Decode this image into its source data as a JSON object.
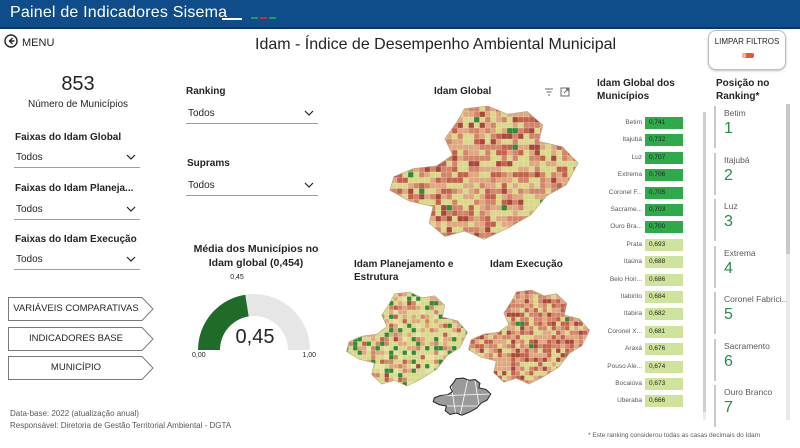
{
  "header": {
    "app_title": "Painel de Indicadores Sisema",
    "flag_colors": [
      "#1e9e4a",
      "#d62828",
      "#1e9e4a"
    ]
  },
  "nav": {
    "menu_label": "MENU",
    "back_icon": "circle-arrow-left-icon"
  },
  "page_title": "Idam - Índice de Desempenho Ambiental Municipal",
  "clear_filters": {
    "label": "LIMPAR FILTROS",
    "icon": "eraser-icon"
  },
  "kpi": {
    "value": "853",
    "label": "Número de Municípios"
  },
  "filters": {
    "global": {
      "label": "Faixas do Idam Global",
      "value": "Todos"
    },
    "planejamento": {
      "label": "Faixas do Idam Planeja...",
      "value": "Todos"
    },
    "execucao": {
      "label": "Faixas do Idam Execução",
      "value": "Todos"
    },
    "ranking": {
      "label": "Ranking",
      "value": "Todos"
    },
    "suprams": {
      "label": "Suprams",
      "value": "Todos"
    }
  },
  "buttons": {
    "variaveis": "VARIÁVEIS COMPARATIVAS",
    "indicadores": "INDICADORES BASE",
    "municipio": "MUNICÍPIO"
  },
  "footer": {
    "line1": "Data-base: 2022 (atualização anual)",
    "line2": "Responsável: Diretoria de Gestão Territorial Ambiental - DGTA"
  },
  "gauge": {
    "title": "Média dos Municípios no Idam global (0,454)",
    "value": 0.45,
    "value_label": "0,45",
    "min_label": "0,00",
    "max_label": "1,00",
    "target_label": "0,45",
    "fill_color": "#1f6b2a",
    "track_color": "#e6e6e6"
  },
  "maps": {
    "global_title": "Idam Global",
    "planejamento_title": "Idam Planejamento e Estrutura",
    "execucao_title": "Idam Execução",
    "filter_icon": "filter-icon",
    "focus_icon": "focus-mode-icon",
    "palette": [
      "#d9d98a",
      "#e0a882",
      "#d4846a",
      "#c4614e",
      "#a9473e",
      "#2e8b3a",
      "#e8e3a0"
    ]
  },
  "ranking_bars": {
    "title": "Idam Global dos Municípios",
    "rows": [
      {
        "name": "Betim",
        "value": "0,741",
        "color": "#2eaa4a"
      },
      {
        "name": "Itajubá",
        "value": "0,732",
        "color": "#2eaa4a"
      },
      {
        "name": "Luz",
        "value": "0,707",
        "color": "#2eaa4a"
      },
      {
        "name": "Extrema",
        "value": "0,706",
        "color": "#2eaa4a"
      },
      {
        "name": "Coronel F...",
        "value": "0,705",
        "color": "#2eaa4a"
      },
      {
        "name": "Sacrame...",
        "value": "0,703",
        "color": "#2eaa4a"
      },
      {
        "name": "Ouro Bra...",
        "value": "0,700",
        "color": "#2eaa4a"
      },
      {
        "name": "Prata",
        "value": "0,693",
        "color": "#cfe39a"
      },
      {
        "name": "Itaúna",
        "value": "0,688",
        "color": "#cfe39a"
      },
      {
        "name": "Belo Hori...",
        "value": "0,686",
        "color": "#cfe39a"
      },
      {
        "name": "Itabirito",
        "value": "0,684",
        "color": "#cfe39a"
      },
      {
        "name": "Itabira",
        "value": "0,682",
        "color": "#cfe39a"
      },
      {
        "name": "Coronel X...",
        "value": "0,681",
        "color": "#cfe39a"
      },
      {
        "name": "Araxá",
        "value": "0,676",
        "color": "#cfe39a"
      },
      {
        "name": "Pouso Ale...",
        "value": "0,674",
        "color": "#cfe39a"
      },
      {
        "name": "Bocaiúva",
        "value": "0,673",
        "color": "#cfe39a"
      },
      {
        "name": "Uberaba",
        "value": "0,666",
        "color": "#cfe39a"
      }
    ]
  },
  "positions": {
    "title": "Posição no Ranking*",
    "items": [
      {
        "name": "Betim",
        "rank": "1"
      },
      {
        "name": "Itajubá",
        "rank": "2"
      },
      {
        "name": "Luz",
        "rank": "3"
      },
      {
        "name": "Extrema",
        "rank": "4"
      },
      {
        "name": "Coronel Fabrici...",
        "rank": "5"
      },
      {
        "name": "Sacramento",
        "rank": "6"
      },
      {
        "name": "Ouro Branco",
        "rank": "7"
      }
    ]
  },
  "footnote": "* Este ranking considerou todas as casas decimais do Idam"
}
